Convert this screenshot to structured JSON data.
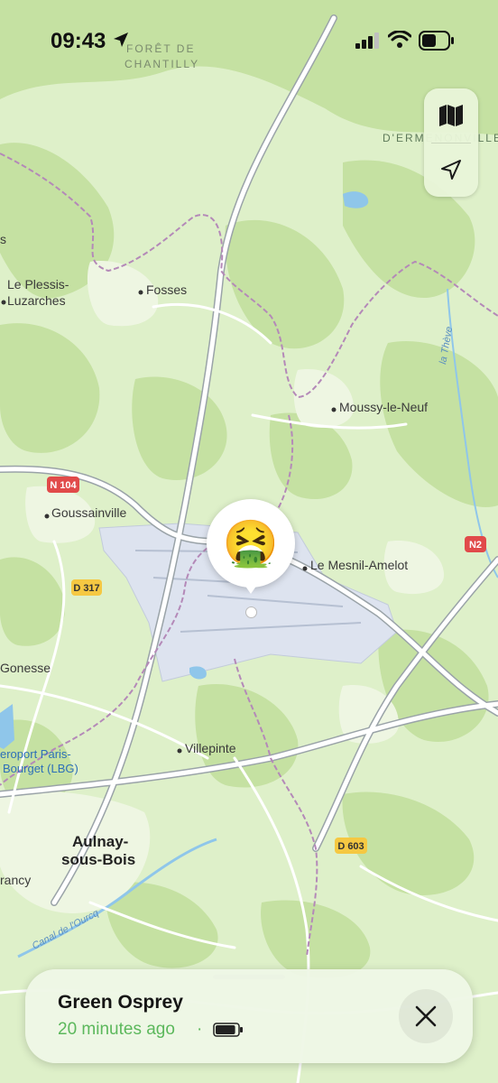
{
  "status_bar": {
    "time": "09:43"
  },
  "map": {
    "places": [
      {
        "id": "foret-1",
        "text": "FORÊT DE"
      },
      {
        "id": "foret-2",
        "text": "CHANTILLY"
      },
      {
        "id": "ermenonville",
        "text": "D'ERMENONVILLE"
      },
      {
        "id": "plessis-1",
        "text": "Le Plessis-"
      },
      {
        "id": "plessis-2",
        "text": "Luzarches"
      },
      {
        "id": "fosses",
        "text": "Fosses"
      },
      {
        "id": "moussy",
        "text": "Moussy-le-Neuf"
      },
      {
        "id": "goussainville",
        "text": "Goussainville"
      },
      {
        "id": "mesnil",
        "text": "Le Mesnil-Amelot"
      },
      {
        "id": "gonesse",
        "text": "Gonesse"
      },
      {
        "id": "villepinte",
        "text": "Villepinte"
      },
      {
        "id": "aulnay-1",
        "text": "Aulnay-"
      },
      {
        "id": "aulnay-2",
        "text": "sous-Bois"
      },
      {
        "id": "drancy",
        "text": "rancy"
      },
      {
        "id": "lbg-1",
        "text": "eroport Paris-"
      },
      {
        "id": "lbg-2",
        "text": "Bourget (LBG)"
      },
      {
        "id": "theve",
        "text": "la Thève"
      },
      {
        "id": "ourcq",
        "text": "Canal de l'Ourcq"
      },
      {
        "id": "s-edge",
        "text": "s"
      }
    ],
    "road_labels": [
      {
        "id": "n104",
        "text": "N 104"
      },
      {
        "id": "n2",
        "text": "N2"
      },
      {
        "id": "d317",
        "text": "D 317"
      },
      {
        "id": "d603",
        "text": "D 603"
      }
    ],
    "controls": [
      {
        "id": "map-mode",
        "icon": "map-icon"
      },
      {
        "id": "locate",
        "icon": "location-arrow-icon"
      }
    ],
    "pin": {
      "emoji": "🤮"
    }
  },
  "card": {
    "title": "Green Osprey",
    "subtitle": "20 minutes ago",
    "separator": "·",
    "battery_level": 0.9
  },
  "colors": {
    "park": "#c7e3a6",
    "land": "#def0c9",
    "airport": "#dde3ef",
    "boundary": "#b489b8",
    "road": "#ffffff",
    "road_casing": "#9aa3a8",
    "water": "#8fc6ea",
    "road_badge_red": "#e14a4a",
    "road_badge_yellow": "#f5c842",
    "accent_green": "#5cb85c"
  }
}
